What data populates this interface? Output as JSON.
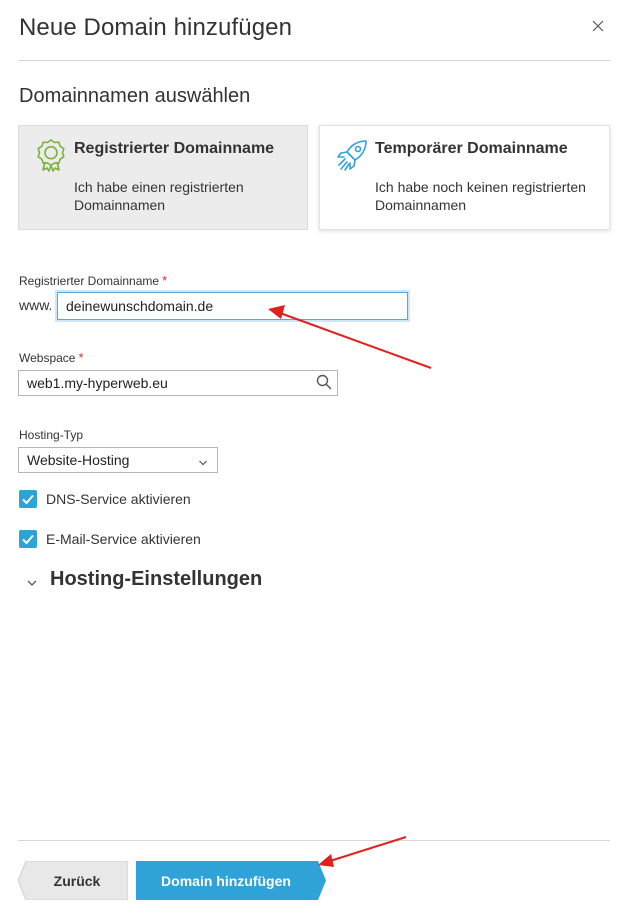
{
  "dialog": {
    "title": "Neue Domain hinzufügen",
    "close_icon": "close-icon"
  },
  "domain_section": {
    "title": "Domainnamen auswählen",
    "cards": [
      {
        "title": "Registrierter Domainname",
        "description": "Ich habe einen registrierten Domainnamen",
        "icon": "certificate-badge-icon",
        "icon_color": "#7bb23a",
        "selected": true
      },
      {
        "title": "Temporärer Domainname",
        "description": "Ich habe noch keinen registrierten Domainnamen",
        "icon": "rocket-icon",
        "icon_color": "#2fa2d8",
        "selected": false
      }
    ]
  },
  "form": {
    "domain": {
      "label": "Registrierter Domainname",
      "required_marker": "*",
      "prefix": "www.",
      "value": "deinewunschdomain.de"
    },
    "webspace": {
      "label": "Webspace",
      "required_marker": "*",
      "value": "web1.my-hyperweb.eu",
      "icon": "search-icon"
    },
    "hosting_type": {
      "label": "Hosting-Typ",
      "selected": "Website-Hosting"
    },
    "checkboxes": [
      {
        "label": "DNS-Service aktivieren",
        "checked": true
      },
      {
        "label": "E-Mail-Service aktivieren",
        "checked": true
      }
    ],
    "hosting_settings": {
      "title": "Hosting-Einstellungen",
      "expanded": false
    }
  },
  "footer": {
    "back_label": "Zurück",
    "submit_label": "Domain hinzufügen"
  },
  "colors": {
    "accent": "#2fa2d8",
    "required": "#d02b2b",
    "annotation_arrow": "#e3211c",
    "selected_card_bg": "#ececec"
  }
}
